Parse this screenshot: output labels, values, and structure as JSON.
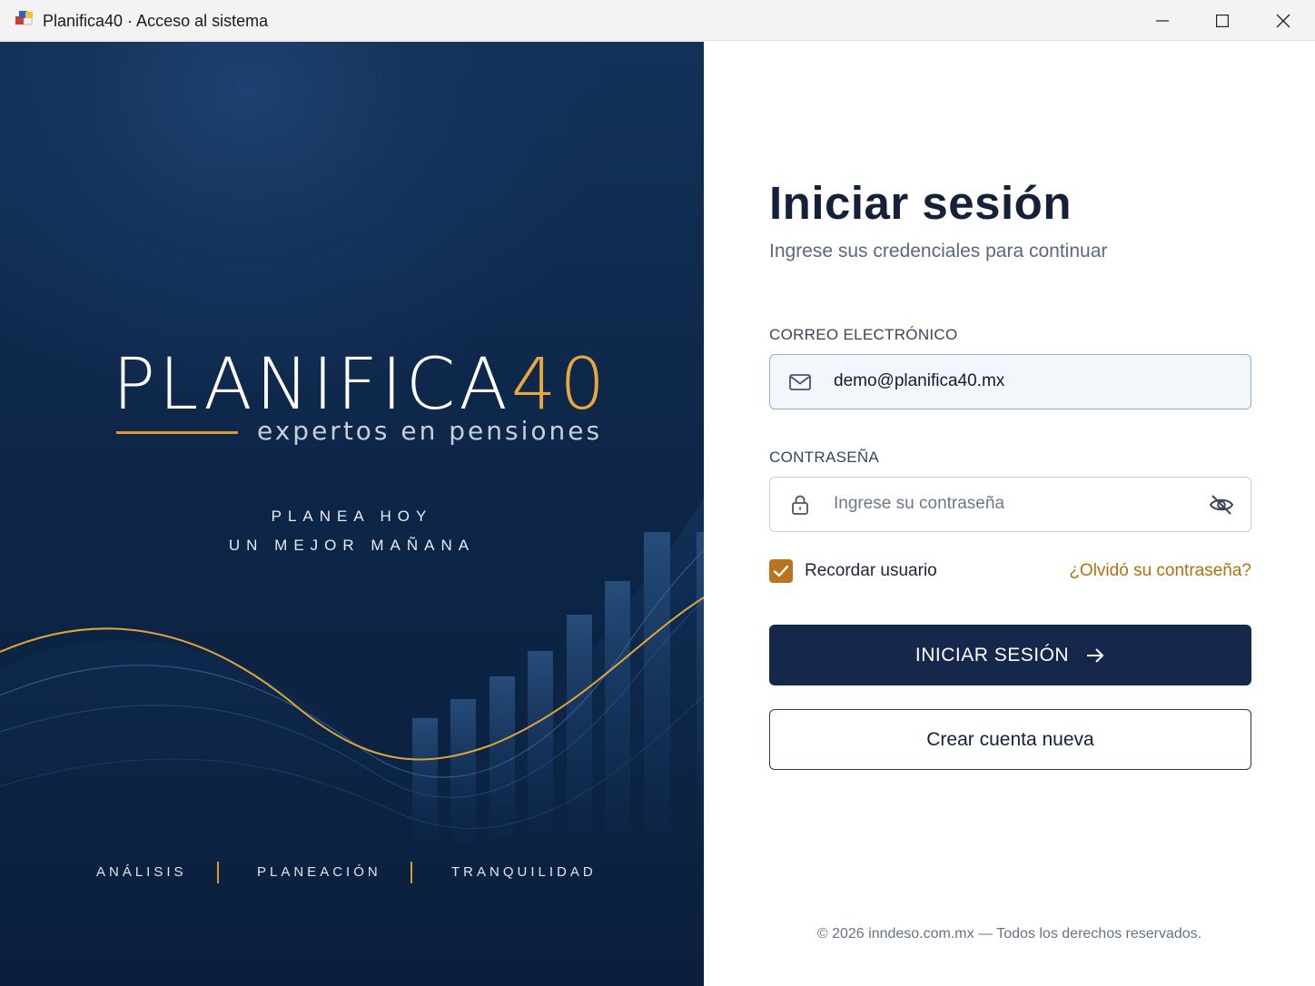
{
  "window": {
    "title": "Planifica40 · Acceso al sistema",
    "controls": [
      "minimize-icon",
      "maximize-icon",
      "close-icon"
    ]
  },
  "brand": {
    "logo_word": "PLANIFICA",
    "logo_number": "40",
    "tagline": "expertos en pensiones",
    "slogan_line1": "PLANEA HOY",
    "slogan_line2": "UN MEJOR MAÑANA",
    "pillars": [
      "ANÁLISIS",
      "PLANEACIÓN",
      "TRANQUILIDAD"
    ],
    "colors": {
      "navy": "#0d2648",
      "gold": "#e8a83d"
    }
  },
  "login": {
    "title": "Iniciar sesión",
    "subtitle": "Ingrese sus credenciales para continuar",
    "email_label": "CORREO ELECTRÓNICO",
    "email_value": "demo@planifica40.mx",
    "email_icon": "mail-icon",
    "password_label": "CONTRASEÑA",
    "password_value": "",
    "password_placeholder": "Ingrese su contraseña",
    "password_icon": "lock-icon",
    "password_toggle_icon": "eye-off-icon",
    "remember_label": "Recordar usuario",
    "remember_checked": true,
    "forgot_link": "¿Olvidó su contraseña?",
    "submit_label": "INICIAR SESIÓN",
    "submit_icon": "arrow-right-icon",
    "create_account_label": "Crear cuenta nueva",
    "footer": "© 2026 inndeso.com.mx  —  Todos los derechos reservados.",
    "colors": {
      "primary": "#15284b",
      "accent": "#b8741e",
      "link": "#b26f13"
    }
  }
}
